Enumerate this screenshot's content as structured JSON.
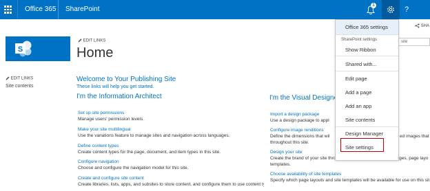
{
  "suite_bar": {
    "brand": "Office 365",
    "product": "SharePoint",
    "notification_count": "1",
    "help_label": "?"
  },
  "share_label": "SHA",
  "search": {
    "value": "site"
  },
  "site": {
    "edit_links_top": "EDIT LINKS",
    "title": "Home",
    "edit_links_left": "EDIT LINKS",
    "site_contents": "Site contents"
  },
  "welcome": {
    "title": "Welcome to Your Publishing Site",
    "subtitle": "These links will help you get started."
  },
  "architect": {
    "title": "I'm the Information Architect",
    "items": [
      {
        "link": "Set up site permissions",
        "desc": "Manage users' permission levels."
      },
      {
        "link": "Make your site multilingual",
        "desc": "Use the variations feature to manage sites and navigation across languages."
      },
      {
        "link": "Define content types",
        "desc": "Create content types for the page, document, and item types in this site."
      },
      {
        "link": "Configure navigation",
        "desc": "Choose and configure the navigation model for this site."
      },
      {
        "link": "Create and configure site content",
        "desc": "Create libraries, lists, apps, and subsites to store content, and configure them to use content types."
      }
    ]
  },
  "designer": {
    "title": "I'm the Visual Designer",
    "items": [
      {
        "link": "Import a design package",
        "desc": "Use a design package to appl"
      },
      {
        "link": "Configure image renditions",
        "desc": "Define the dimensions that wil",
        "desc_right": "ed images that"
      },
      {
        "link": "",
        "desc": "throughout this site."
      },
      {
        "link": "Design your site",
        "desc": "Create the brand of your site through device channels, master pages, page layo"
      },
      {
        "link": "",
        "desc": "templates."
      },
      {
        "link": "Choose availability of site templates",
        "desc": "Specify which page layouts and site templates will be available for use on this sit"
      }
    ]
  },
  "settings_menu": {
    "header": "Office 365 settings",
    "section_label": "SharePoint settings",
    "items": [
      "Show Ribbon",
      "Shared with...",
      "Edit page",
      "Add a page",
      "Add an app",
      "Site contents",
      "Design Manager",
      "Site settings"
    ],
    "highlighted_item": "Site settings"
  },
  "colors": {
    "suite_bar": "#0072c6",
    "link": "#0072c6",
    "highlight_border": "#c00000"
  }
}
